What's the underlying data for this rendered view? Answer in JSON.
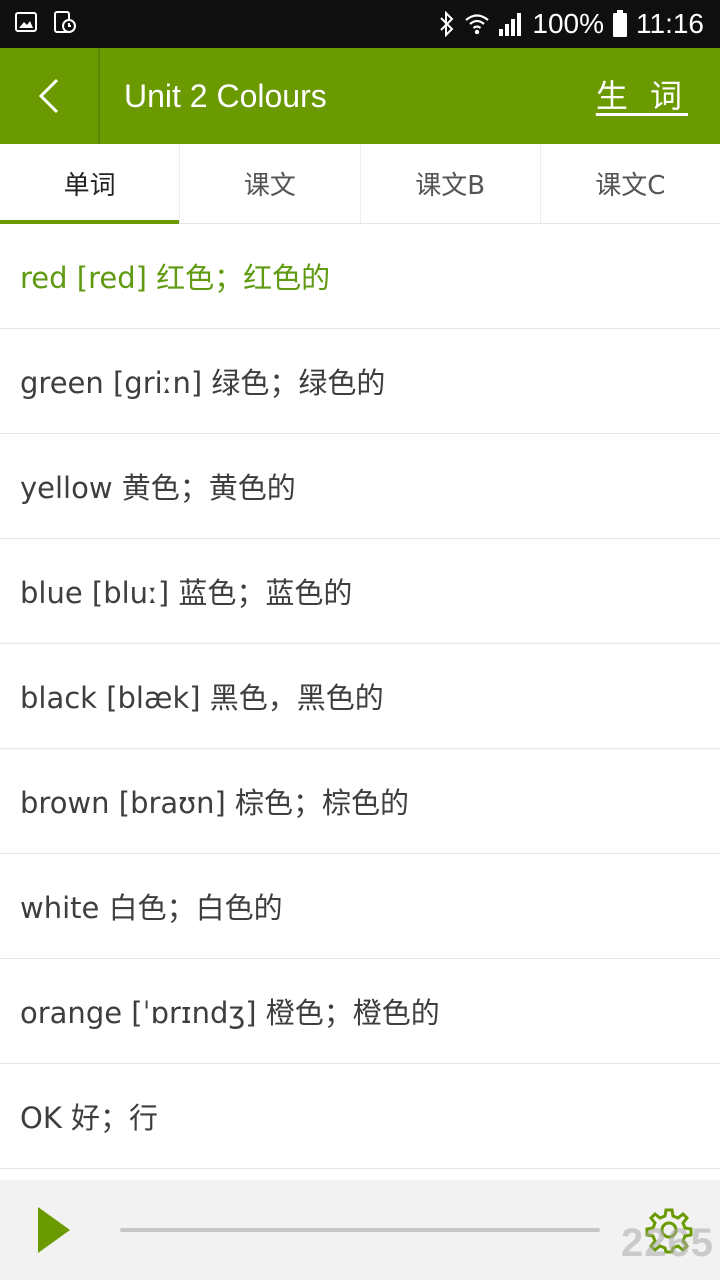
{
  "status_bar": {
    "battery": "100%",
    "time": "11:16"
  },
  "app_bar": {
    "title": "Unit 2 Colours",
    "new_words": "生 词"
  },
  "tabs": [
    {
      "label": "单词",
      "active": true
    },
    {
      "label": "课文",
      "active": false
    },
    {
      "label": "课文B",
      "active": false
    },
    {
      "label": "课文C",
      "active": false
    }
  ],
  "words": [
    {
      "text": "red [red] 红色；红色的",
      "selected": true
    },
    {
      "text": "green [griːn]  绿色；绿色的",
      "selected": false
    },
    {
      "text": "yellow 黄色；黄色的",
      "selected": false
    },
    {
      "text": "blue [bluː]  蓝色；蓝色的",
      "selected": false
    },
    {
      "text": "black [blæk]  黑色，黑色的",
      "selected": false
    },
    {
      "text": "brown [braʊn]  棕色；棕色的",
      "selected": false
    },
    {
      "text": "white 白色；白色的",
      "selected": false
    },
    {
      "text": "orange [ˈɒrɪndʒ]  橙色；橙色的",
      "selected": false
    },
    {
      "text": "OK 好；行",
      "selected": false
    }
  ],
  "player": {
    "progress": 0
  },
  "watermark": "2265",
  "colors": {
    "accent": "#6a9a00",
    "selected_text": "#5f9a10",
    "status_bar": "#0f0f0f"
  }
}
